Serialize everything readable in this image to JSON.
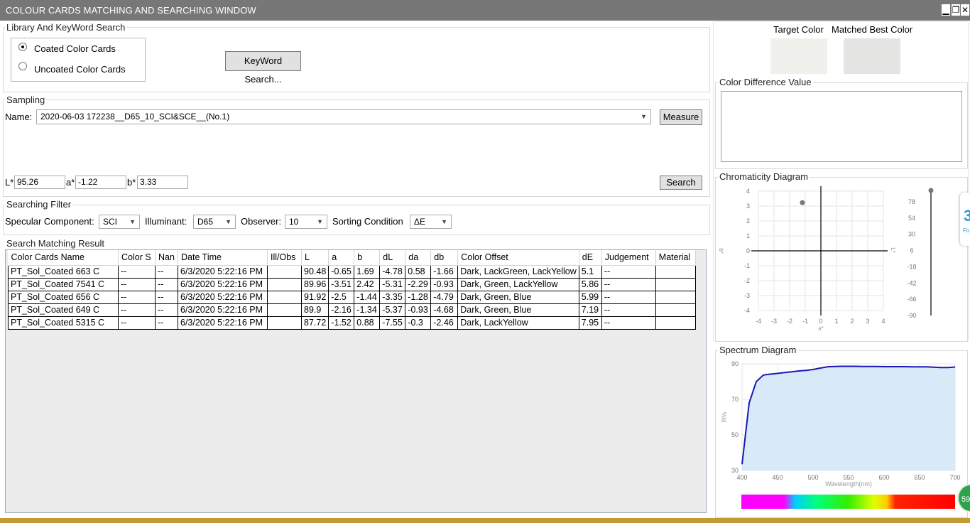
{
  "window": {
    "title": "COLOUR CARDS MATCHING AND SEARCHING WINDOW",
    "minimize": "▁",
    "restore": "❐",
    "close": "✕"
  },
  "library": {
    "group_label": "Library And KeyWord Search",
    "options": [
      "Coated Color Cards",
      "Uncoated Color Cards"
    ],
    "selected": "Coated Color Cards",
    "keyword_button": "KeyWord Search..."
  },
  "sampling": {
    "group_label": "Sampling",
    "name_label": "Name:",
    "name_value": "2020-06-03 172238__D65_10_SCI&SCE__(No.1)",
    "measure_button": "Measure",
    "l_label": "L*",
    "l_value": "95.26",
    "a_label": "a*",
    "a_value": "-1.22",
    "b_label": "b*",
    "b_value": "3.33",
    "search_button": "Search"
  },
  "filter": {
    "group_label": "Searching Filter",
    "specular_label": "Specular Component:",
    "specular_value": "SCI",
    "illuminant_label": "Illuminant:",
    "illuminant_value": "D65",
    "observer_label": "Observer:",
    "observer_value": "10",
    "sorting_label": "Sorting Condition",
    "sorting_value": "ΔE"
  },
  "results": {
    "group_label": "Search Matching Result",
    "columns": [
      "Color Cards Name",
      "Color S",
      "Nan",
      "Date Time",
      "Ill/Obs",
      "L",
      "a",
      "b",
      "dL",
      "da",
      "db",
      "Color Offset",
      "dE",
      "Judgement",
      "Material"
    ],
    "rows": [
      [
        "PT_Sol_Coated 663 C",
        "--",
        "--",
        "6/3/2020 5:22:16 PM",
        "",
        "90.48",
        "-0.65",
        "1.69",
        "-4.78",
        "0.58",
        "-1.66",
        "Dark, LackGreen, LackYellow",
        "5.1",
        "--",
        ""
      ],
      [
        "PT_Sol_Coated 7541 C",
        "--",
        "--",
        "6/3/2020 5:22:16 PM",
        "",
        "89.96",
        "-3.51",
        "2.42",
        "-5.31",
        "-2.29",
        "-0.93",
        "Dark, Green, LackYellow",
        "5.86",
        "--",
        ""
      ],
      [
        "PT_Sol_Coated 656 C",
        "--",
        "--",
        "6/3/2020 5:22:16 PM",
        "",
        "91.92",
        "-2.5",
        "-1.44",
        "-3.35",
        "-1.28",
        "-4.79",
        "Dark, Green, Blue",
        "5.99",
        "--",
        ""
      ],
      [
        "PT_Sol_Coated 649 C",
        "--",
        "--",
        "6/3/2020 5:22:16 PM",
        "",
        "89.9",
        "-2.16",
        "-1.34",
        "-5.37",
        "-0.93",
        "-4.68",
        "Dark, Green, Blue",
        "7.19",
        "--",
        ""
      ],
      [
        "PT_Sol_Coated 5315 C",
        "--",
        "--",
        "6/3/2020 5:22:16 PM",
        "",
        "87.72",
        "-1.52",
        "0.88",
        "-7.55",
        "-0.3",
        "-2.46",
        "Dark, LackYellow",
        "7.95",
        "--",
        ""
      ]
    ]
  },
  "colors": {
    "target_label": "Target Color",
    "matched_label": "Matched Best Color",
    "target_swatch": "#f0f1ec",
    "matched_swatch": "#e4e5e2",
    "title_bar": "#777777",
    "spectrum_line": "#1a17b8",
    "spectrum_fill": "#d8e9f7"
  },
  "difference": {
    "group_label": "Color Difference Value"
  },
  "chromaticity": {
    "group_label": "Chromaticity Diagram",
    "ab_ticks": [
      "4",
      "3",
      "2",
      "1",
      "0",
      "-1",
      "-2",
      "-3",
      "-4"
    ],
    "x_ticks": [
      "-4",
      "-3",
      "-2",
      "-1",
      "0",
      "1",
      "2",
      "3",
      "4"
    ],
    "a_axis_label": "a*",
    "b_axis_label": "b*",
    "l_axis_label": "L*",
    "l_ticks": [
      "78",
      "54",
      "30",
      "6",
      "-18",
      "-42",
      "-66",
      "-90"
    ],
    "point_a": -1.22,
    "point_b": 3.33,
    "point_l": 95.26
  },
  "spectrum": {
    "group_label": "Spectrum Diagram",
    "y_label": "R%",
    "x_label": "Wavelength(nm)",
    "x_ticks": [
      "400",
      "450",
      "500",
      "550",
      "600",
      "650",
      "700"
    ],
    "y_ticks": [
      "90",
      "70",
      "50",
      "30"
    ]
  },
  "chart_data": {
    "type": "area",
    "xlabel": "Wavelength(nm)",
    "ylabel": "R%",
    "xlim": [
      400,
      700
    ],
    "ylim": [
      30,
      90
    ],
    "x": [
      400,
      410,
      420,
      430,
      440,
      450,
      460,
      470,
      480,
      490,
      500,
      510,
      520,
      530,
      540,
      550,
      560,
      570,
      580,
      590,
      600,
      610,
      620,
      630,
      640,
      650,
      660,
      670,
      680,
      690,
      700
    ],
    "series": [
      {
        "values": [
          33.5,
          68,
          80,
          83.7,
          84.2,
          84.6,
          85.1,
          85.5,
          86,
          86.3,
          86.8,
          87.6,
          88.3,
          88.5,
          88.6,
          88.6,
          88.6,
          88.5,
          88.5,
          88.5,
          88.4,
          88.4,
          88.4,
          88.4,
          88.3,
          88.3,
          88.3,
          88.1,
          87.9,
          87.9,
          88.2
        ]
      }
    ]
  },
  "side_tab": {
    "glyph": "3",
    "text": "Fo"
  },
  "badge": {
    "text": "59"
  }
}
